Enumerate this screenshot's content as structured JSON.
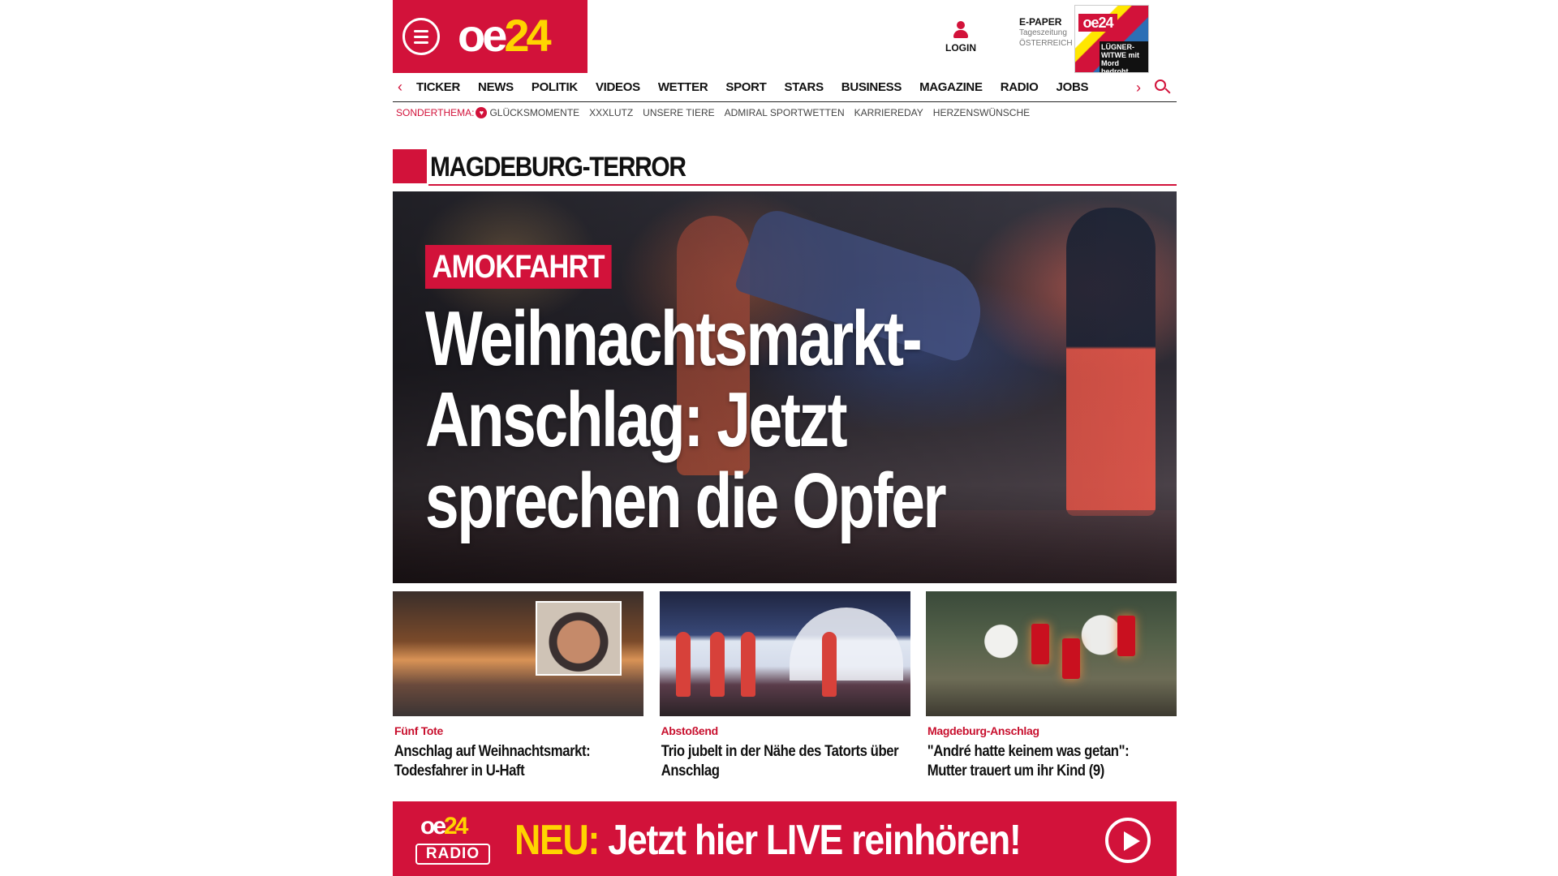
{
  "brand": {
    "logo_oe": "oe",
    "logo_24": "24",
    "primary_color": "#d2123a",
    "accent_color": "#ffd400"
  },
  "header": {
    "login_label": "LOGIN",
    "epaper_title": "E-PAPER",
    "epaper_sub1": "Tageszeitung",
    "epaper_sub2": "ÖSTERREICH",
    "epaper_cover_logo": "oe24",
    "epaper_cover_headline": "LÜGNER-WITWE mit Mord bedroht"
  },
  "nav": {
    "items": [
      "TICKER",
      "NEWS",
      "POLITIK",
      "VIDEOS",
      "WETTER",
      "SPORT",
      "STARS",
      "BUSINESS",
      "MAGAZINE",
      "RADIO",
      "JOBS"
    ]
  },
  "subnav": {
    "label": "SONDERTHEMA:",
    "items": [
      "GLÜCKSMOMENTE",
      "XXXLUTZ",
      "UNSERE TIERE",
      "ADMIRAL SPORTWETTEN",
      "KARRIEREDAY",
      "HERZENSWÜNSCHE"
    ]
  },
  "section": {
    "title": "MAGDEBURG-TERROR"
  },
  "hero": {
    "kicker": "AMOKFAHRT",
    "headline": "Weihnachtsmarkt-Anschlag: Jetzt sprechen die Opfer"
  },
  "cards": [
    {
      "kicker": "Fünf Tote",
      "title": "Anschlag auf Weihnachtsmarkt: Todesfahrer in U-Haft"
    },
    {
      "kicker": "Abstoßend",
      "title": "Trio jubelt in der Nähe des Tatorts über Anschlag"
    },
    {
      "kicker": "Magdeburg-Anschlag",
      "title": "\"André hatte keinem was getan\": Mutter trauert um ihr Kind (9)"
    }
  ],
  "radio_banner": {
    "logo_oe": "oe",
    "logo_24": "24",
    "logo_radio": "RADIO",
    "neu": "NEU:",
    "text": "Jetzt hier LIVE reinhören!"
  }
}
